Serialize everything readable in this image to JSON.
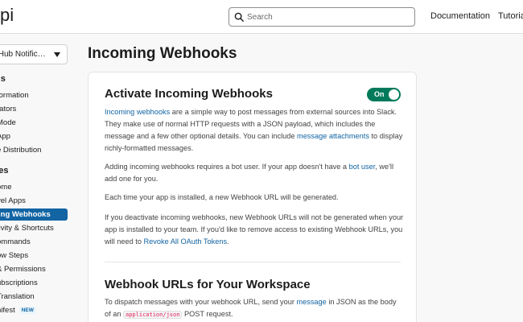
{
  "header": {
    "logo_text": "pi",
    "search_placeholder": "Search",
    "nav": [
      "Documentation",
      "Tutorials"
    ]
  },
  "sidebar": {
    "app_selector": "tHub Notific…",
    "sections": [
      {
        "heading": "gs",
        "items": [
          "formation",
          "rators",
          "Mode",
          "App",
          "e Distribution"
        ]
      },
      {
        "heading": "res",
        "items": [
          "ome",
          "vel Apps",
          "ing Webhooks",
          "tivity & Shortcuts",
          "ommands",
          "ow Steps",
          "& Permissions",
          "ubscriptions",
          "Translation",
          "nifest"
        ]
      }
    ],
    "new_badge": "NEW",
    "active_item": "ing Webhooks"
  },
  "main": {
    "page_title": "Incoming Webhooks",
    "activate": {
      "title": "Activate Incoming Webhooks",
      "toggle_label": "On",
      "p1_link1": "Incoming webhooks",
      "p1_text1": " are a simple way to post messages from external sources into Slack. They make use of normal HTTP requests with a JSON payload, which includes the message and a few other optional details. You can include ",
      "p1_link2": "message attachments",
      "p1_text2": " to display richly-formatted messages.",
      "p2_text1": "Adding incoming webhooks requires a bot user. If your app doesn't have a ",
      "p2_link": "bot user",
      "p2_text2": ", we'll add one for you.",
      "p3_text": "Each time your app is installed, a new Webhook URL will be generated.",
      "p4_text1": "If you deactivate incoming webhooks, new Webhook URLs will not be generated when your app is installed to your team. If you'd like to remove access to existing Webhook URLs, you will need to ",
      "p4_link": "Revoke All OAuth Tokens",
      "p4_text2": "."
    },
    "workspace": {
      "title": "Webhook URLs for Your Workspace",
      "p_text1": "To dispatch messages with your webhook URL, send your ",
      "p_link": "message",
      "p_text2": " in JSON as the body of an ",
      "p_code": "application/json",
      "p_text3": " POST request."
    }
  },
  "colors": {
    "accent": "#1264a3",
    "toggle_on": "#007a5a",
    "code": "#e01e5a"
  }
}
